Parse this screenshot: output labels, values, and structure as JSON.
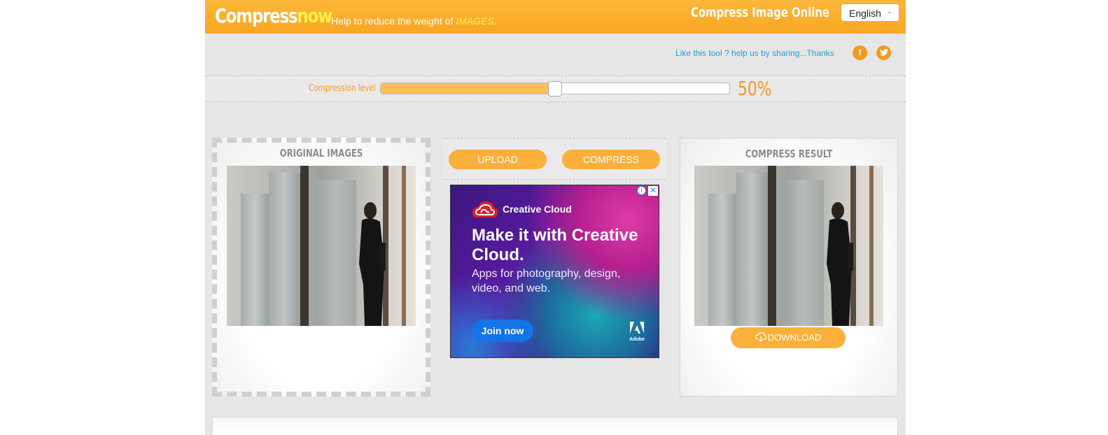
{
  "header": {
    "logo_part1": "Compress",
    "logo_part2": "now",
    "tagline_prefix": "Help to reduce the weight of ",
    "tagline_emphasis": "IMAGES.",
    "title": "Compress Image Online",
    "language": "English"
  },
  "share": {
    "text": "Like this tool ? help us by sharing...Thanks",
    "facebook_icon": "facebook-icon",
    "twitter_icon": "twitter-icon"
  },
  "compression": {
    "label": "Compression level",
    "value_text": "50%",
    "level_fraction": 0.5
  },
  "original": {
    "title": "ORIGINAL IMAGES"
  },
  "result": {
    "title": "COMPRESS RESULT",
    "download_label": "DOWNLOAD",
    "download_icon": "cloud-download-icon"
  },
  "actions": {
    "upload_label": "UPLOAD",
    "compress_label": "COMPRESS"
  },
  "ad": {
    "brand": "Creative Cloud",
    "headline": "Make it with Creative Cloud.",
    "body": "Apps for photography, design, video, and web.",
    "cta": "Join now",
    "adobe_name": "Adobe",
    "info_glyph": "i",
    "close_glyph": "✕"
  },
  "colors": {
    "brand_orange": "#f9a623",
    "accent_yellow": "#fff34a",
    "button_orange": "#fbb03b",
    "link_blue": "#1e9fd4",
    "panel_grey": "#e6e6e6"
  }
}
